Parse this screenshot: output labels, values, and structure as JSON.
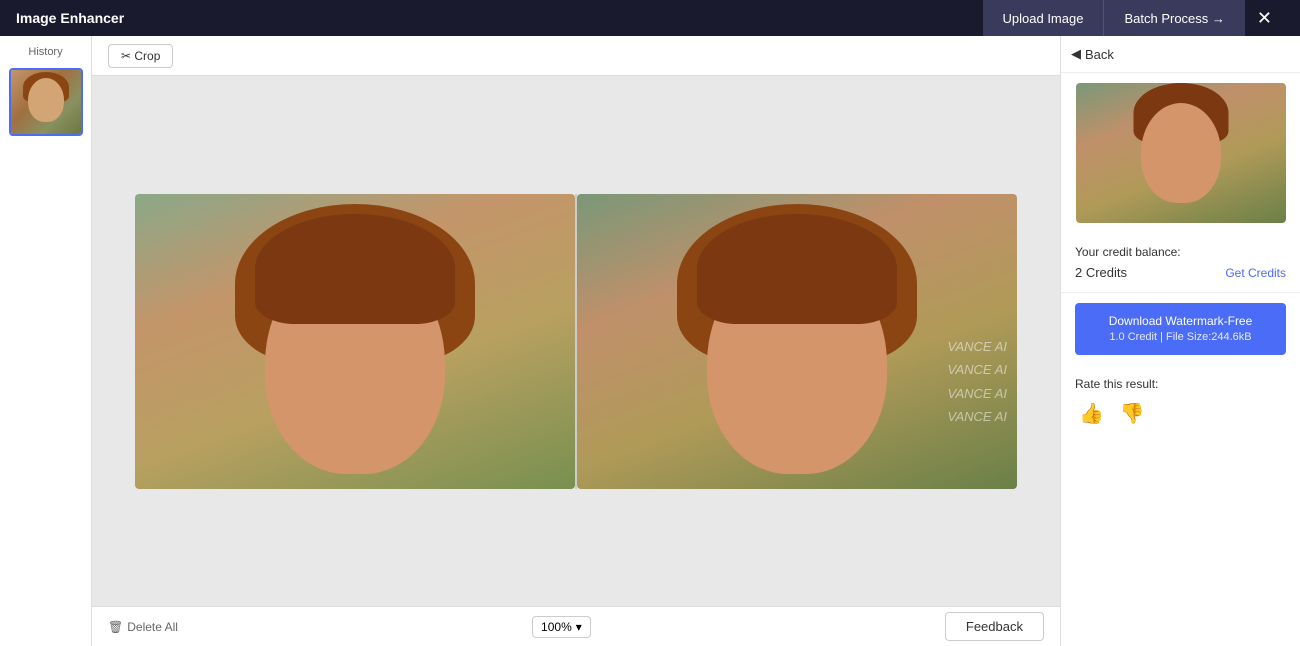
{
  "app": {
    "title": "Image Enhancer"
  },
  "header": {
    "upload_label": "Upload Image",
    "batch_label": "Batch Process →",
    "close_icon": "✕"
  },
  "sidebar_left": {
    "history_label": "History"
  },
  "crop_toolbar": {
    "crop_label": "✂ Crop"
  },
  "bottom_bar": {
    "delete_label": "Delete All",
    "zoom_value": "100%",
    "feedback_label": "Feedback"
  },
  "right_panel": {
    "back_label": "Back",
    "credit_balance_label": "Your credit balance:",
    "credit_count": "2 Credits",
    "get_credits_label": "Get Credits",
    "download_label": "Download Watermark-Free",
    "download_sub": "1.0 Credit | File Size:244.6kB",
    "rate_label": "Rate this result:"
  },
  "watermark": {
    "lines": [
      "VANCE AI",
      "VANCE AI",
      "VANCE AI",
      "VANCE AI"
    ]
  }
}
